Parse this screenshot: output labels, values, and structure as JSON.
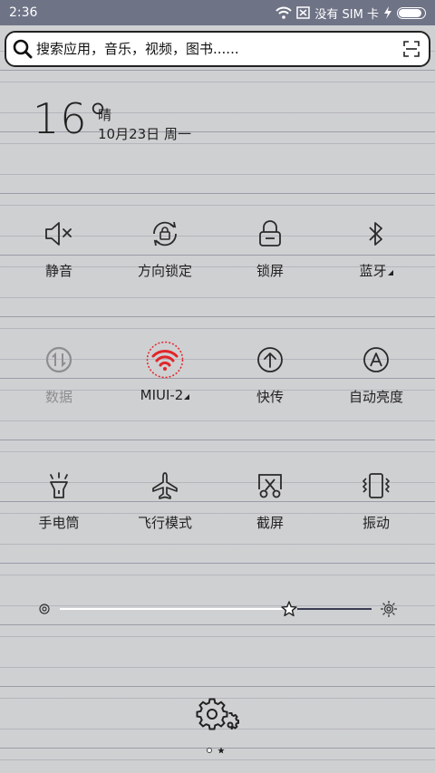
{
  "status_bar": {
    "time": "2:36",
    "network_text": "没有 SIM 卡",
    "battery_level": 0.95
  },
  "search": {
    "placeholder": "搜索应用，音乐，视频，图书......"
  },
  "weather": {
    "temperature": "16°",
    "condition": "晴",
    "date": "10月23日 周一"
  },
  "toggles": [
    {
      "label": "静音",
      "icon": "mute-icon",
      "active": false,
      "has_menu": false
    },
    {
      "label": "方向锁定",
      "icon": "rotation-lock-icon",
      "active": false,
      "has_menu": false
    },
    {
      "label": "锁屏",
      "icon": "lock-icon",
      "active": false,
      "has_menu": false
    },
    {
      "label": "蓝牙",
      "icon": "bluetooth-icon",
      "active": false,
      "has_menu": true
    },
    {
      "label": "数据",
      "icon": "mobile-data-icon",
      "active": false,
      "disabled": true,
      "has_menu": false
    },
    {
      "label": "MIUI-2",
      "icon": "wifi-icon",
      "active": true,
      "has_menu": true
    },
    {
      "label": "快传",
      "icon": "quick-transfer-icon",
      "active": false,
      "has_menu": false
    },
    {
      "label": "自动亮度",
      "icon": "auto-brightness-icon",
      "active": false,
      "has_menu": false
    },
    {
      "label": "手电筒",
      "icon": "flashlight-icon",
      "active": false,
      "has_menu": false
    },
    {
      "label": "飞行模式",
      "icon": "airplane-icon",
      "active": false,
      "has_menu": false
    },
    {
      "label": "截屏",
      "icon": "screenshot-icon",
      "active": false,
      "has_menu": false
    },
    {
      "label": "振动",
      "icon": "vibrate-icon",
      "active": false,
      "has_menu": false
    }
  ],
  "brightness": {
    "level": 0.72
  },
  "pager": {
    "current_page": 1,
    "page_count": 2
  },
  "colors": {
    "status_bar": "#6f7386",
    "wifi_active": "#e0262a",
    "icon": "#2a2a2a",
    "disabled": "#8e8e90"
  }
}
